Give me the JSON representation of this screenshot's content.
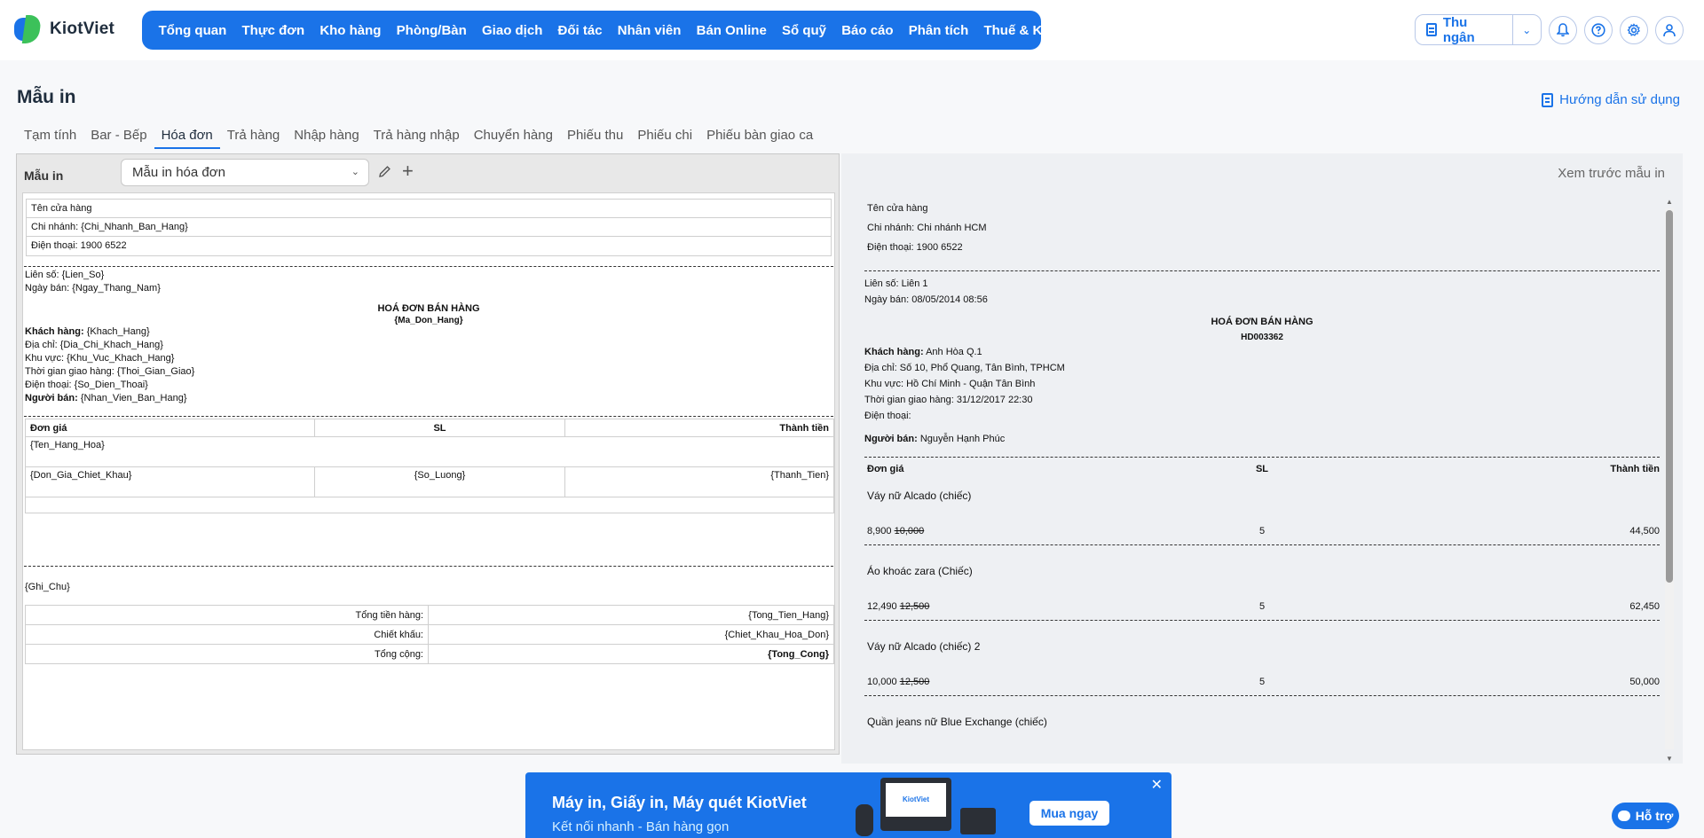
{
  "app": {
    "brand": "KiotViet"
  },
  "nav": [
    "Tổng quan",
    "Thực đơn",
    "Kho hàng",
    "Phòng/Bàn",
    "Giao dịch",
    "Đối tác",
    "Nhân viên",
    "Bán Online",
    "Sổ quỹ",
    "Báo cáo",
    "Phân tích",
    "Thuế & Kế toán"
  ],
  "header": {
    "cashier_label": "Thu ngân"
  },
  "page": {
    "title": "Mẫu in",
    "guide_label": "Hướng dẫn sử dụng"
  },
  "tabs": [
    "Tạm tính",
    "Bar - Bếp",
    "Hóa đơn",
    "Trả hàng",
    "Nhập hàng",
    "Trả hàng nhập",
    "Chuyển hàng",
    "Phiếu thu",
    "Phiếu chi",
    "Phiếu bàn giao ca"
  ],
  "editor": {
    "label": "Mẫu in",
    "selected_template": "Mẫu in hóa đơn",
    "store_name": "Tên cửa hàng",
    "branch": "Chi nhánh: {Chi_Nhanh_Ban_Hang}",
    "phone": "Điện thoại: 1900 6522",
    "lien_so": "Liên số: {Lien_So}",
    "ngay_ban": "Ngày bán: {Ngay_Thang_Nam}",
    "invoice_title": "HOÁ ĐƠN BÁN HÀNG",
    "invoice_code": "{Ma_Don_Hang}",
    "customer_label": "Khách hàng:",
    "customer_value": "{Khach_Hang}",
    "address": "Địa chỉ: {Dia_Chi_Khach_Hang}",
    "area": "Khu vực: {Khu_Vuc_Khach_Hang}",
    "delivery": "Thời gian giao hàng: {Thoi_Gian_Giao}",
    "cust_phone": "Điện thoại: {So_Dien_Thoai}",
    "seller_label": "Người bán:",
    "seller_value": "{Nhan_Vien_Ban_Hang}",
    "col_price": "Đơn giá",
    "col_qty": "SL",
    "col_total": "Thành tiền",
    "item_name": "{Ten_Hang_Hoa}",
    "item_price": "{Don_Gia_Chiet_Khau}",
    "item_qty": "{So_Luong}",
    "item_total": "{Thanh_Tien}",
    "note": "{Ghi_Chu}",
    "sum_label_1": "Tổng tiền hàng:",
    "sum_value_1": "{Tong_Tien_Hang}",
    "sum_label_2": "Chiết khấu:",
    "sum_value_2": "{Chiet_Khau_Hoa_Don}",
    "sum_label_3": "Tổng cộng:",
    "sum_value_3": "{Tong_Cong}"
  },
  "preview": {
    "title": "Xem trước mẫu in",
    "store_name": "Tên cửa hàng",
    "branch": "Chi nhánh: Chi nhánh HCM",
    "phone": "Điện thoại: 1900 6522",
    "lien_so": "Liên số: Liên 1",
    "ngay_ban": "Ngày bán: 08/05/2014 08:56",
    "invoice_title": "HOÁ ĐƠN BÁN HÀNG",
    "invoice_code": "HD003362",
    "customer_label": "Khách hàng:",
    "customer_value": "Anh Hòa Q.1",
    "address": "Địa chỉ: Số 10, Phổ Quang, Tân Bình, TPHCM",
    "area": "Khu vực: Hồ Chí Minh - Quận Tân Bình",
    "delivery": "Thời gian giao hàng: 31/12/2017 22:30",
    "cust_phone": "Điện thoại:",
    "seller_label": "Người bán:",
    "seller_value": "Nguyễn Hạnh Phúc",
    "col_price": "Đơn giá",
    "col_qty": "SL",
    "col_total": "Thành tiền",
    "items": [
      {
        "name": "Váy nữ Alcado (chiếc)",
        "price": "8,900",
        "old_price": "10,000",
        "qty": "5",
        "total": "44,500"
      },
      {
        "name": "Áo khoác zara (Chiếc)",
        "price": "12,490",
        "old_price": "12,500",
        "qty": "5",
        "total": "62,450"
      },
      {
        "name": "Váy nữ Alcado (chiếc) 2",
        "price": "10,000",
        "old_price": "12,500",
        "qty": "5",
        "total": "50,000"
      },
      {
        "name": "Quần jeans nữ Blue Exchange (chiếc)"
      }
    ]
  },
  "banner": {
    "headline": "Máy in, Giấy in, Máy quét KiotViet",
    "subline": "Kết nối nhanh - Bán hàng gọn",
    "cta": "Mua ngay",
    "device_brand": "KiotViet"
  },
  "support": {
    "label": "Hỗ trợ"
  },
  "icons": {
    "logo": "kiotviet-logo-icon",
    "cashier": "document-icon",
    "dropdown": "chevron-down-icon",
    "bell": "bell-icon",
    "help": "help-icon",
    "settings": "gear-icon",
    "user": "user-icon",
    "guide": "book-icon",
    "edit": "pencil-icon",
    "add": "plus-icon",
    "close": "close-icon",
    "chat": "chat-icon"
  },
  "colors": {
    "primary": "#1a73e8",
    "logo_green": "#3cc15a"
  }
}
